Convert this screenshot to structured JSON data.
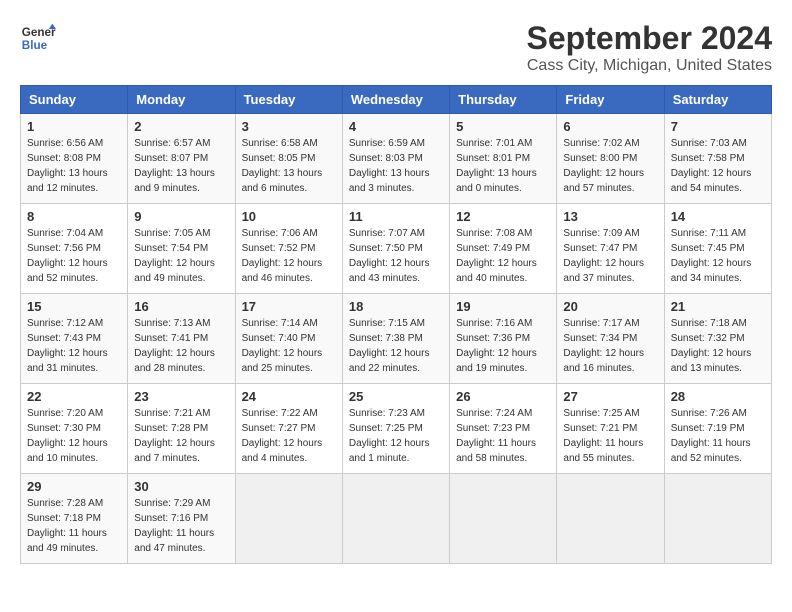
{
  "header": {
    "logo_line1": "General",
    "logo_line2": "Blue",
    "month": "September 2024",
    "location": "Cass City, Michigan, United States"
  },
  "days_of_week": [
    "Sunday",
    "Monday",
    "Tuesday",
    "Wednesday",
    "Thursday",
    "Friday",
    "Saturday"
  ],
  "weeks": [
    [
      {
        "day": "1",
        "sunrise": "6:56 AM",
        "sunset": "8:08 PM",
        "daylight": "13 hours and 12 minutes."
      },
      {
        "day": "2",
        "sunrise": "6:57 AM",
        "sunset": "8:07 PM",
        "daylight": "13 hours and 9 minutes."
      },
      {
        "day": "3",
        "sunrise": "6:58 AM",
        "sunset": "8:05 PM",
        "daylight": "13 hours and 6 minutes."
      },
      {
        "day": "4",
        "sunrise": "6:59 AM",
        "sunset": "8:03 PM",
        "daylight": "13 hours and 3 minutes."
      },
      {
        "day": "5",
        "sunrise": "7:01 AM",
        "sunset": "8:01 PM",
        "daylight": "13 hours and 0 minutes."
      },
      {
        "day": "6",
        "sunrise": "7:02 AM",
        "sunset": "8:00 PM",
        "daylight": "12 hours and 57 minutes."
      },
      {
        "day": "7",
        "sunrise": "7:03 AM",
        "sunset": "7:58 PM",
        "daylight": "12 hours and 54 minutes."
      }
    ],
    [
      {
        "day": "8",
        "sunrise": "7:04 AM",
        "sunset": "7:56 PM",
        "daylight": "12 hours and 52 minutes."
      },
      {
        "day": "9",
        "sunrise": "7:05 AM",
        "sunset": "7:54 PM",
        "daylight": "12 hours and 49 minutes."
      },
      {
        "day": "10",
        "sunrise": "7:06 AM",
        "sunset": "7:52 PM",
        "daylight": "12 hours and 46 minutes."
      },
      {
        "day": "11",
        "sunrise": "7:07 AM",
        "sunset": "7:50 PM",
        "daylight": "12 hours and 43 minutes."
      },
      {
        "day": "12",
        "sunrise": "7:08 AM",
        "sunset": "7:49 PM",
        "daylight": "12 hours and 40 minutes."
      },
      {
        "day": "13",
        "sunrise": "7:09 AM",
        "sunset": "7:47 PM",
        "daylight": "12 hours and 37 minutes."
      },
      {
        "day": "14",
        "sunrise": "7:11 AM",
        "sunset": "7:45 PM",
        "daylight": "12 hours and 34 minutes."
      }
    ],
    [
      {
        "day": "15",
        "sunrise": "7:12 AM",
        "sunset": "7:43 PM",
        "daylight": "12 hours and 31 minutes."
      },
      {
        "day": "16",
        "sunrise": "7:13 AM",
        "sunset": "7:41 PM",
        "daylight": "12 hours and 28 minutes."
      },
      {
        "day": "17",
        "sunrise": "7:14 AM",
        "sunset": "7:40 PM",
        "daylight": "12 hours and 25 minutes."
      },
      {
        "day": "18",
        "sunrise": "7:15 AM",
        "sunset": "7:38 PM",
        "daylight": "12 hours and 22 minutes."
      },
      {
        "day": "19",
        "sunrise": "7:16 AM",
        "sunset": "7:36 PM",
        "daylight": "12 hours and 19 minutes."
      },
      {
        "day": "20",
        "sunrise": "7:17 AM",
        "sunset": "7:34 PM",
        "daylight": "12 hours and 16 minutes."
      },
      {
        "day": "21",
        "sunrise": "7:18 AM",
        "sunset": "7:32 PM",
        "daylight": "12 hours and 13 minutes."
      }
    ],
    [
      {
        "day": "22",
        "sunrise": "7:20 AM",
        "sunset": "7:30 PM",
        "daylight": "12 hours and 10 minutes."
      },
      {
        "day": "23",
        "sunrise": "7:21 AM",
        "sunset": "7:28 PM",
        "daylight": "12 hours and 7 minutes."
      },
      {
        "day": "24",
        "sunrise": "7:22 AM",
        "sunset": "7:27 PM",
        "daylight": "12 hours and 4 minutes."
      },
      {
        "day": "25",
        "sunrise": "7:23 AM",
        "sunset": "7:25 PM",
        "daylight": "12 hours and 1 minute."
      },
      {
        "day": "26",
        "sunrise": "7:24 AM",
        "sunset": "7:23 PM",
        "daylight": "11 hours and 58 minutes."
      },
      {
        "day": "27",
        "sunrise": "7:25 AM",
        "sunset": "7:21 PM",
        "daylight": "11 hours and 55 minutes."
      },
      {
        "day": "28",
        "sunrise": "7:26 AM",
        "sunset": "7:19 PM",
        "daylight": "11 hours and 52 minutes."
      }
    ],
    [
      {
        "day": "29",
        "sunrise": "7:28 AM",
        "sunset": "7:18 PM",
        "daylight": "11 hours and 49 minutes."
      },
      {
        "day": "30",
        "sunrise": "7:29 AM",
        "sunset": "7:16 PM",
        "daylight": "11 hours and 47 minutes."
      },
      null,
      null,
      null,
      null,
      null
    ]
  ]
}
